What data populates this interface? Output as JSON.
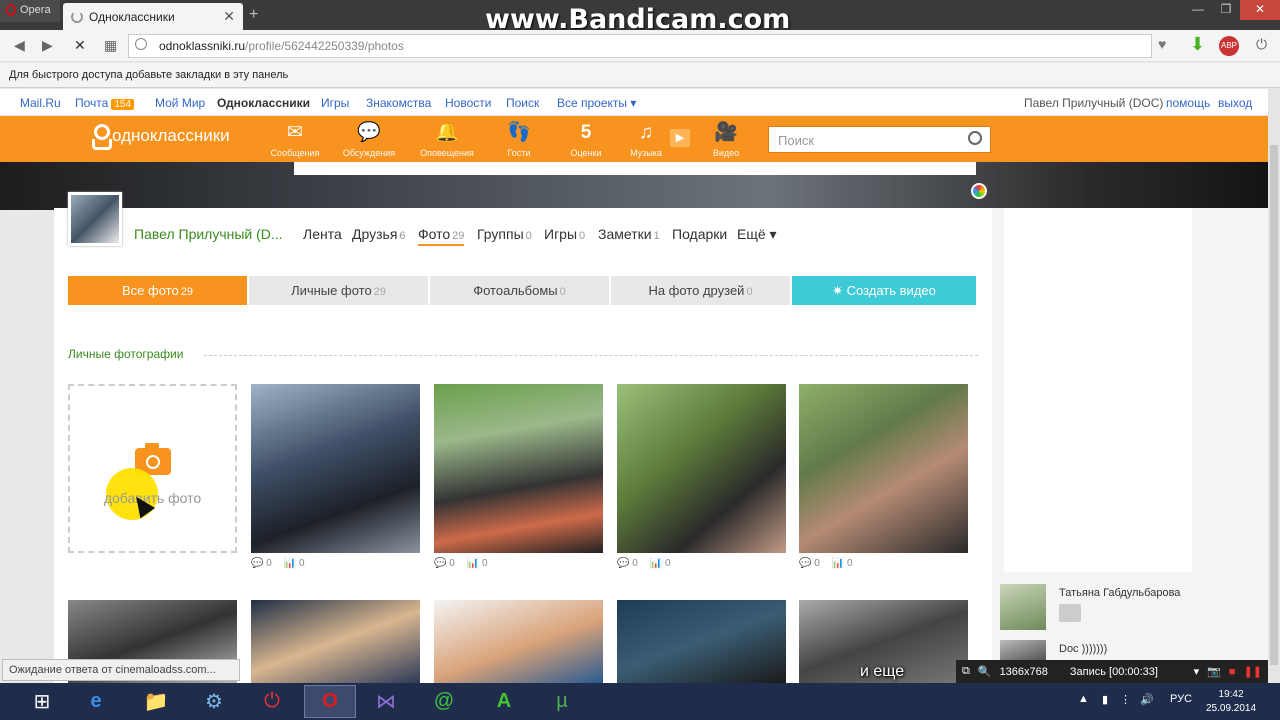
{
  "browser": {
    "opera_label": "Opera",
    "tab_title": "Одноклассники",
    "url_host": "odnoklassniki.ru",
    "url_path": "/profile/562442250339/photos",
    "bookmarks_hint": "Для быстрого доступа добавьте закладки в эту панель"
  },
  "watermark": "www.Bandicam.com",
  "portal": {
    "links": [
      "Mail.Ru",
      "Почта",
      "Мой Мир",
      "Одноклассники",
      "Игры",
      "Знакомства",
      "Новости",
      "Поиск",
      "Все проекты ▾"
    ],
    "mail_badge": "154",
    "user": "Павел Прилучный (DOC)",
    "help": "помощь",
    "logout": "выход"
  },
  "ok": {
    "logo": "одноклассники",
    "icons": [
      {
        "glyph": "✉",
        "label": "Сообщения"
      },
      {
        "glyph": "💬",
        "label": "Обсуждения"
      },
      {
        "glyph": "🔔",
        "label": "Оповещения"
      },
      {
        "glyph": "👣",
        "label": "Гости"
      },
      {
        "glyph": "5",
        "label": "Оценки"
      },
      {
        "glyph": "♫",
        "label": "Музыка"
      },
      {
        "glyph": "🎥",
        "label": "Видео"
      }
    ],
    "search_placeholder": "Поиск"
  },
  "profile": {
    "name": "Павел Прилучный (D...",
    "tabs": [
      {
        "label": "Лента",
        "count": ""
      },
      {
        "label": "Друзья",
        "count": "6"
      },
      {
        "label": "Фото",
        "count": "29"
      },
      {
        "label": "Группы",
        "count": "0"
      },
      {
        "label": "Игры",
        "count": "0"
      },
      {
        "label": "Заметки",
        "count": "1"
      },
      {
        "label": "Подарки",
        "count": ""
      },
      {
        "label": "Ещё ▾",
        "count": ""
      }
    ]
  },
  "subtabs": [
    {
      "label": "Все фото",
      "count": "29"
    },
    {
      "label": "Личные фото",
      "count": "29"
    },
    {
      "label": "Фотоальбомы",
      "count": "0"
    },
    {
      "label": "На фото друзей",
      "count": "0"
    },
    {
      "label": "✷ Создать видео",
      "count": ""
    }
  ],
  "section_title": "Личные фотографии",
  "add_photo": "добавить фото",
  "photo_stats": {
    "comments": "0",
    "views": "0"
  },
  "friends": [
    {
      "name": "Татьяна Габдульбарова"
    },
    {
      "name": "Doc )))))))"
    }
  ],
  "status": "Ожидание ответа от cinemaloadss.com...",
  "caption": "и еще",
  "bandicam": {
    "resolution": "1366x768",
    "record": "Запись [00:00:33]"
  },
  "tray": {
    "lang": "РУС",
    "time": "19:42",
    "date": "25.09.2014"
  }
}
